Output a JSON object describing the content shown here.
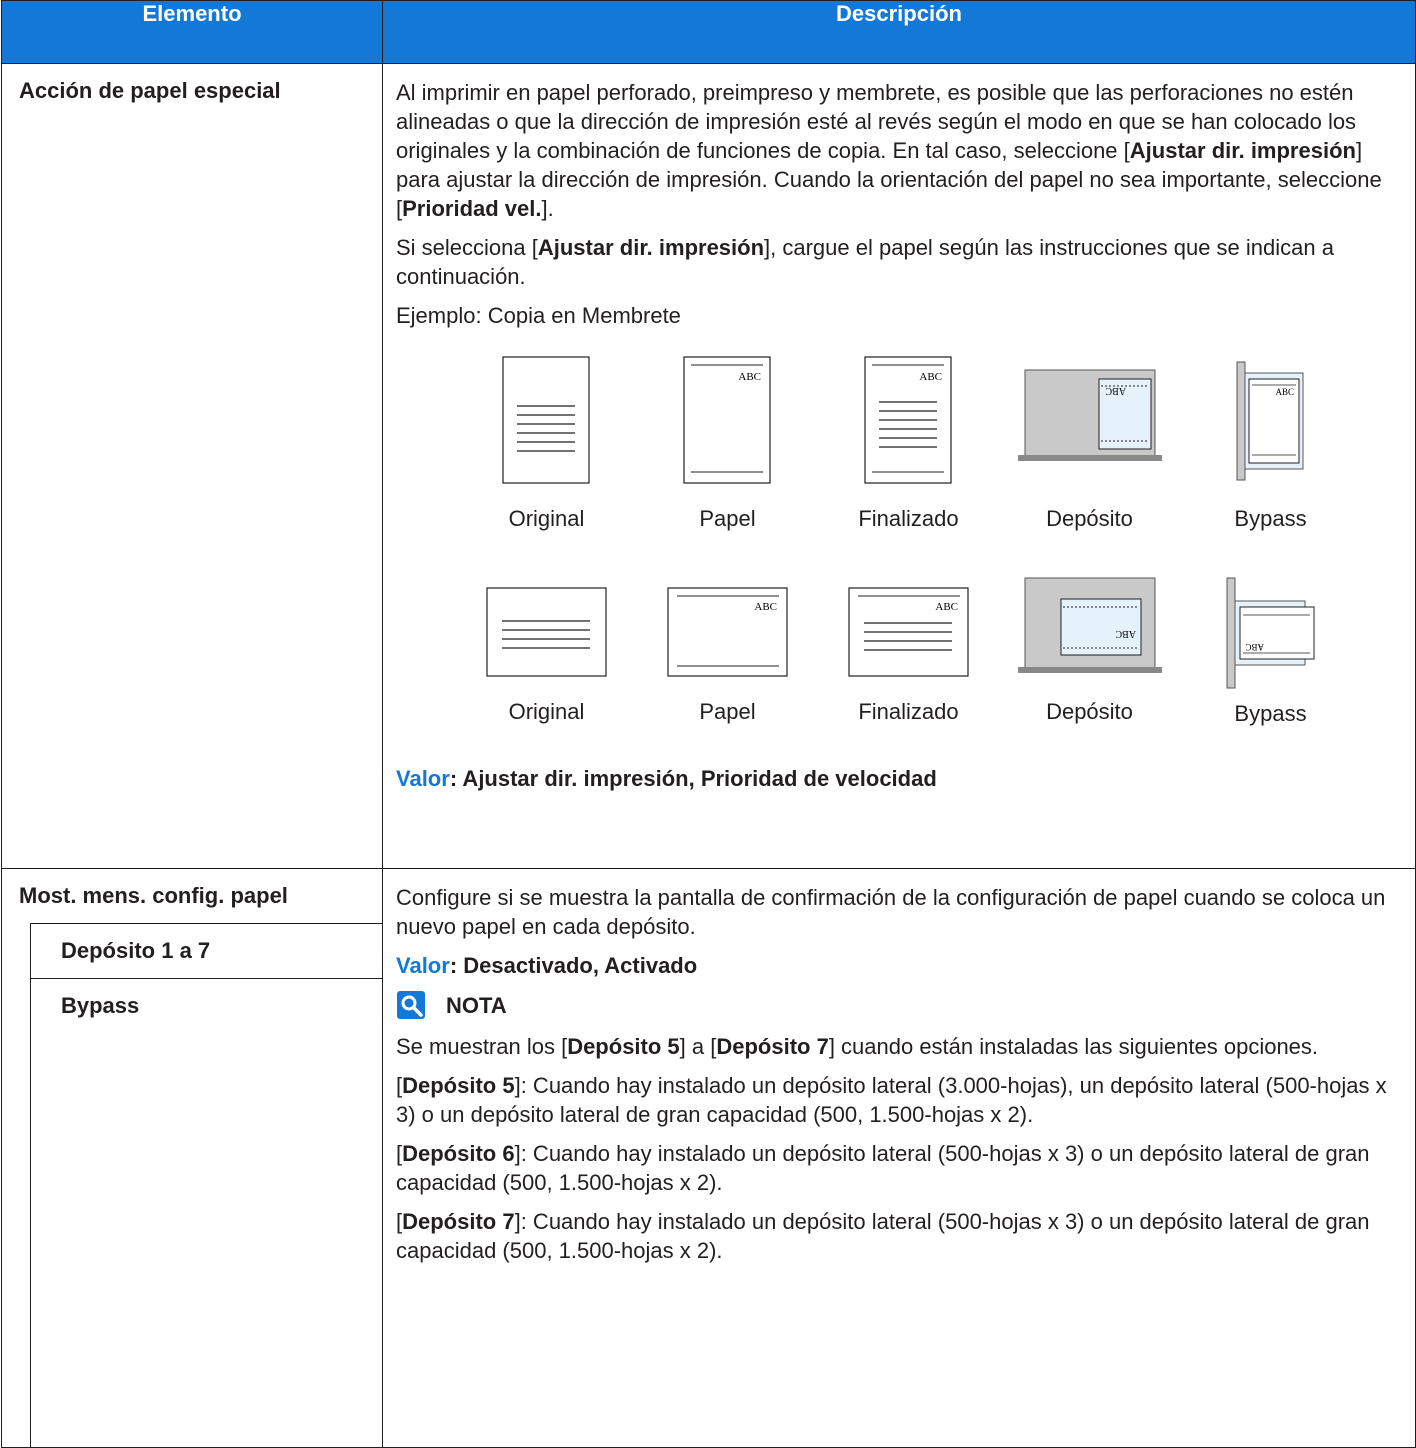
{
  "header": {
    "col1": "Elemento",
    "col2": "Descripción"
  },
  "row1": {
    "label": "Acción de papel especial",
    "p1_a": "Al imprimir en papel perforado, preimpreso y membrete, es posible que las perforaciones no estén alineadas o que la dirección de impresión esté al revés según el modo en que se han colocado los originales y la combinación de funciones de copia. En tal caso, seleccione [",
    "p1_b": "Ajustar dir. impresión",
    "p1_c": "] para ajustar la dirección de impresión. Cuando la orientación del papel no sea importante, seleccione [",
    "p1_d": "Prioridad vel.",
    "p1_e": "].",
    "p2_a": "Si selecciona [",
    "p2_b": "Ajustar dir. impresión",
    "p2_c": "], cargue el papel según las instrucciones que se indican a continuación.",
    "example": "Ejemplo: Copia en Membrete",
    "fig_text": "ABC",
    "captions_row1": [
      "Original",
      "Papel",
      "Finalizado",
      "Depósito",
      "Bypass"
    ],
    "captions_row2": [
      "Original",
      "Papel",
      "Finalizado",
      "Depósito",
      "Bypass"
    ],
    "value_label": "Valor",
    "value_text": ": Ajustar dir. impresión, Prioridad de velocidad"
  },
  "row2": {
    "label": "Most. mens. config. papel",
    "sub1": "Depósito 1 a 7",
    "sub2": "Bypass",
    "p1": "Configure si se muestra la pantalla de confirmación de la configuración de papel cuando se coloca un nuevo papel en cada depósito.",
    "value_label": "Valor",
    "value_text": ": Desactivado, Activado",
    "nota_title": "NOTA",
    "n1_a": "Se muestran los [",
    "n1_b": "Depósito 5",
    "n1_c": "] a [",
    "n1_d": "Depósito 7",
    "n1_e": "] cuando están instaladas las siguientes opciones.",
    "n2_a": "[",
    "n2_b": "Depósito 5",
    "n2_c": "]: Cuando hay instalado un depósito lateral (3.000-hojas), un depósito lateral (500-hojas x 3) o un depósito lateral de gran capacidad (500, 1.500-hojas x 2).",
    "n3_a": "[",
    "n3_b": "Depósito 6",
    "n3_c": "]: Cuando hay instalado un depósito lateral (500-hojas x 3) o un depósito lateral de gran capacidad (500, 1.500-hojas x 2).",
    "n4_a": "[",
    "n4_b": "Depósito 7",
    "n4_c": "]: Cuando hay instalado un depósito lateral (500-hojas x 3) o un depósito lateral de gran capacidad (500, 1.500-hojas x 2)."
  },
  "colors": {
    "header_bg": "#1479d6",
    "accent": "#1479d6",
    "tray_gray": "#c9c9c9"
  }
}
